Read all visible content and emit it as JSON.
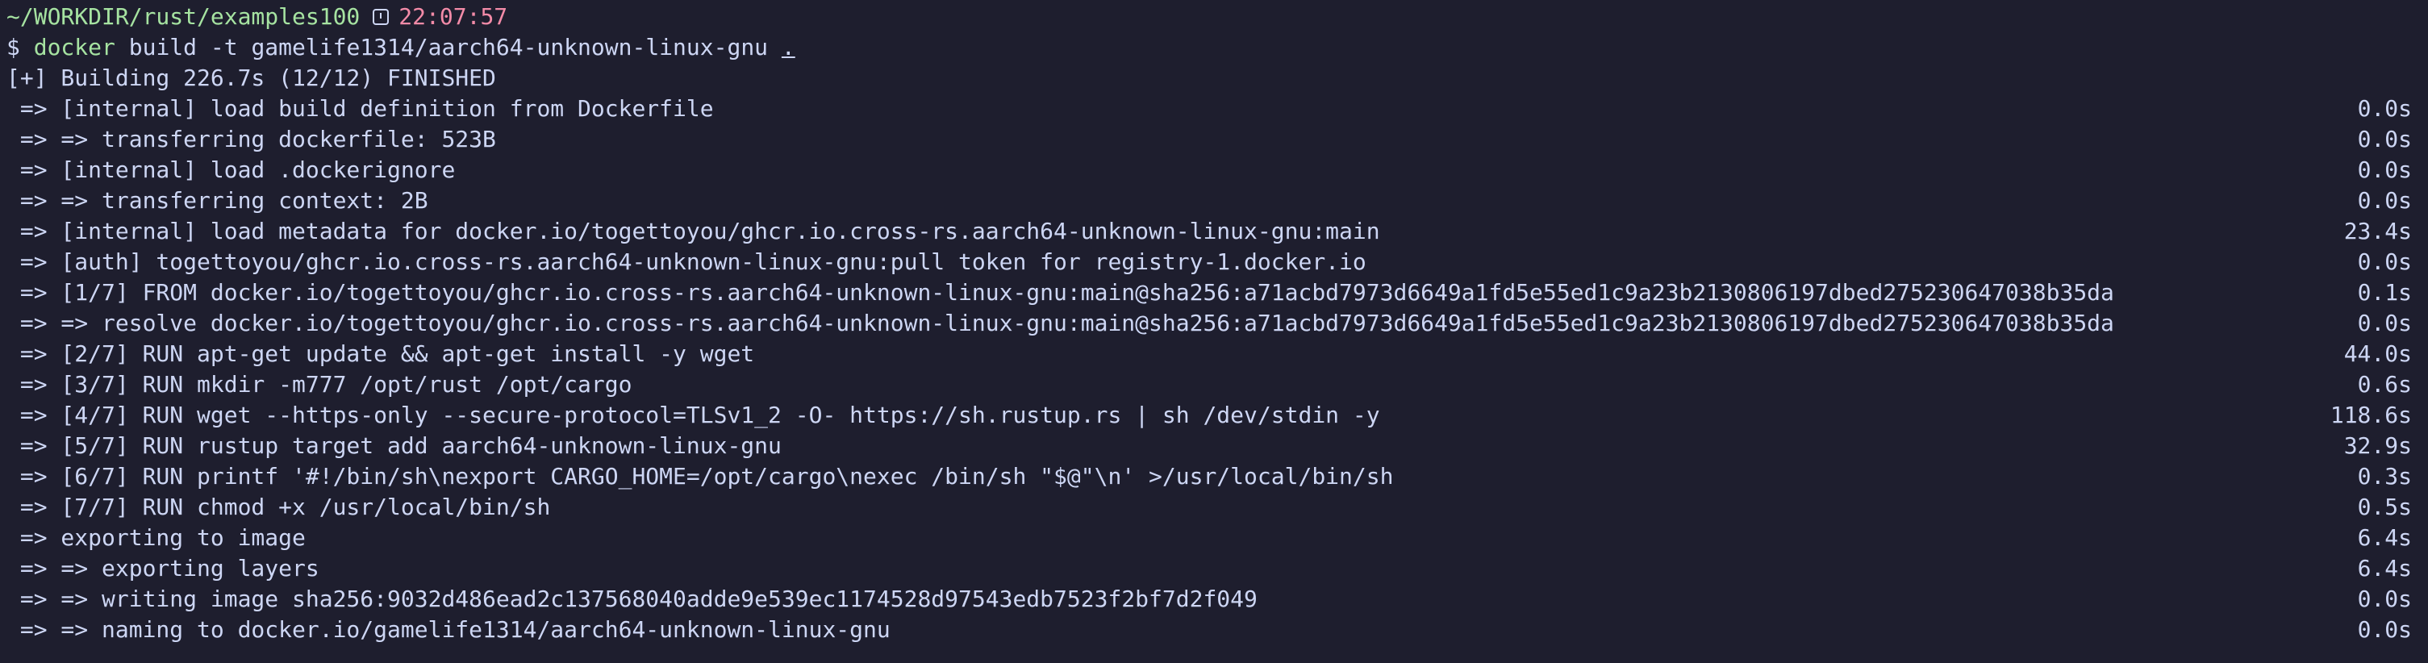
{
  "prompt": {
    "path": "~/WORKDIR/rust/examples100",
    "time": "22:07:57",
    "clock_icon": "clock-icon"
  },
  "command": {
    "symbol": "$ ",
    "program": "docker",
    "args": " build -t gamelife1314/aarch64-unknown-linux-gnu ",
    "context": "."
  },
  "build_header": "[+] Building 226.7s (12/12) FINISHED",
  "steps": [
    {
      "text": " => [internal] load build definition from Dockerfile",
      "duration": "0.0s"
    },
    {
      "text": " => => transferring dockerfile: 523B",
      "duration": "0.0s"
    },
    {
      "text": " => [internal] load .dockerignore",
      "duration": "0.0s"
    },
    {
      "text": " => => transferring context: 2B",
      "duration": "0.0s"
    },
    {
      "text": " => [internal] load metadata for docker.io/togettoyou/ghcr.io.cross-rs.aarch64-unknown-linux-gnu:main",
      "duration": "23.4s"
    },
    {
      "text": " => [auth] togettoyou/ghcr.io.cross-rs.aarch64-unknown-linux-gnu:pull token for registry-1.docker.io",
      "duration": "0.0s"
    },
    {
      "text": " => [1/7] FROM docker.io/togettoyou/ghcr.io.cross-rs.aarch64-unknown-linux-gnu:main@sha256:a71acbd7973d6649a1fd5e55ed1c9a23b2130806197dbed275230647038b35da",
      "duration": "0.1s"
    },
    {
      "text": " => => resolve docker.io/togettoyou/ghcr.io.cross-rs.aarch64-unknown-linux-gnu:main@sha256:a71acbd7973d6649a1fd5e55ed1c9a23b2130806197dbed275230647038b35da",
      "duration": "0.0s"
    },
    {
      "text": " => [2/7] RUN apt-get update && apt-get install -y wget",
      "duration": "44.0s"
    },
    {
      "text": " => [3/7] RUN mkdir -m777 /opt/rust /opt/cargo",
      "duration": "0.6s"
    },
    {
      "text": " => [4/7] RUN wget --https-only --secure-protocol=TLSv1_2 -O- https://sh.rustup.rs | sh /dev/stdin -y",
      "duration": "118.6s"
    },
    {
      "text": " => [5/7] RUN rustup target add aarch64-unknown-linux-gnu",
      "duration": "32.9s"
    },
    {
      "text": " => [6/7] RUN printf '#!/bin/sh\\nexport CARGO_HOME=/opt/cargo\\nexec /bin/sh \"$@\"\\n' >/usr/local/bin/sh",
      "duration": "0.3s"
    },
    {
      "text": " => [7/7] RUN chmod +x /usr/local/bin/sh",
      "duration": "0.5s"
    },
    {
      "text": " => exporting to image",
      "duration": "6.4s"
    },
    {
      "text": " => => exporting layers",
      "duration": "6.4s"
    },
    {
      "text": " => => writing image sha256:9032d486ead2c137568040adde9e539ec1174528d97543edb7523f2bf7d2f049",
      "duration": "0.0s"
    },
    {
      "text": " => => naming to docker.io/gamelife1314/aarch64-unknown-linux-gnu",
      "duration": "0.0s"
    }
  ]
}
